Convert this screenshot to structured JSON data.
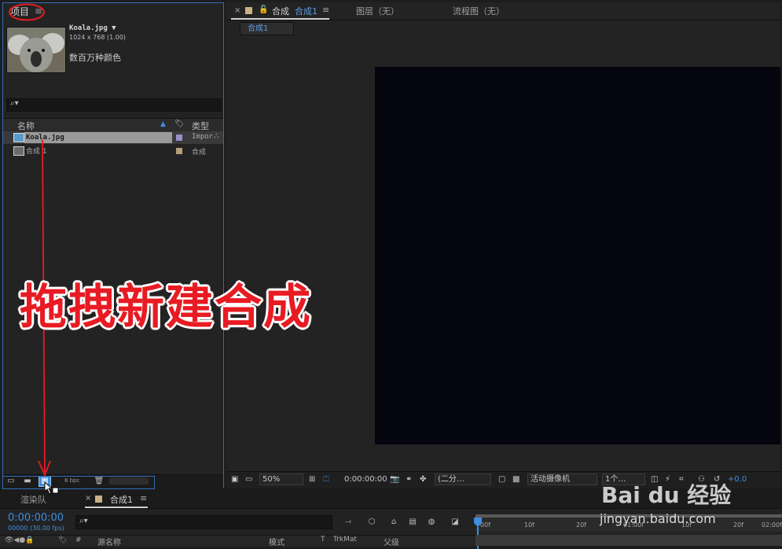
{
  "project": {
    "title": "项目",
    "menu_glyph": "≡",
    "selected_file": {
      "name": "Koala.jpg ▼",
      "dims": "1024 x 768 (1.00)",
      "colors": "数百万种颜色"
    },
    "search_icon": "⌕▾",
    "columns": {
      "name": "名称",
      "type": "类型"
    },
    "items": [
      {
        "name": "Koala.jpg",
        "type": "Impor",
        "swatch": "#9a8fc8"
      },
      {
        "name": "合成 1",
        "type": "合成",
        "swatch": "#b5a07a"
      }
    ],
    "bpc": "8 bpc"
  },
  "comp": {
    "tab_close": "×",
    "tab_label": "合成",
    "tab_active": "合成1",
    "layer_tab": "图层（无）",
    "flow_tab": "流程图（无）",
    "subtab": "合成1",
    "zoom": "50%",
    "timecode": "0:00:00:00",
    "resolution": "(二分…",
    "camera": "活动摄像机",
    "views": "1个…",
    "exposure": "+0.0",
    "canvas_color": "#050510"
  },
  "timeline": {
    "render_tab": "渲染队",
    "comp_tab": "合成1",
    "current_time": "0:00:00:00",
    "fps": "00000 (30.00 fps)",
    "ruler": [
      "00f",
      "10f",
      "20f",
      "01:00f",
      "10f",
      "20f",
      "02:00f"
    ],
    "columns": {
      "num": "#",
      "source": "源名称",
      "mode": "模式",
      "t": "T",
      "trkmat": "TrkMat",
      "parent": "父级"
    }
  },
  "annotation": {
    "caption": "拖拽新建合成",
    "arrow_color": "#e81b23"
  },
  "watermark": {
    "logo": "Bai du 经验",
    "url": "jingyan.baidu.com"
  }
}
